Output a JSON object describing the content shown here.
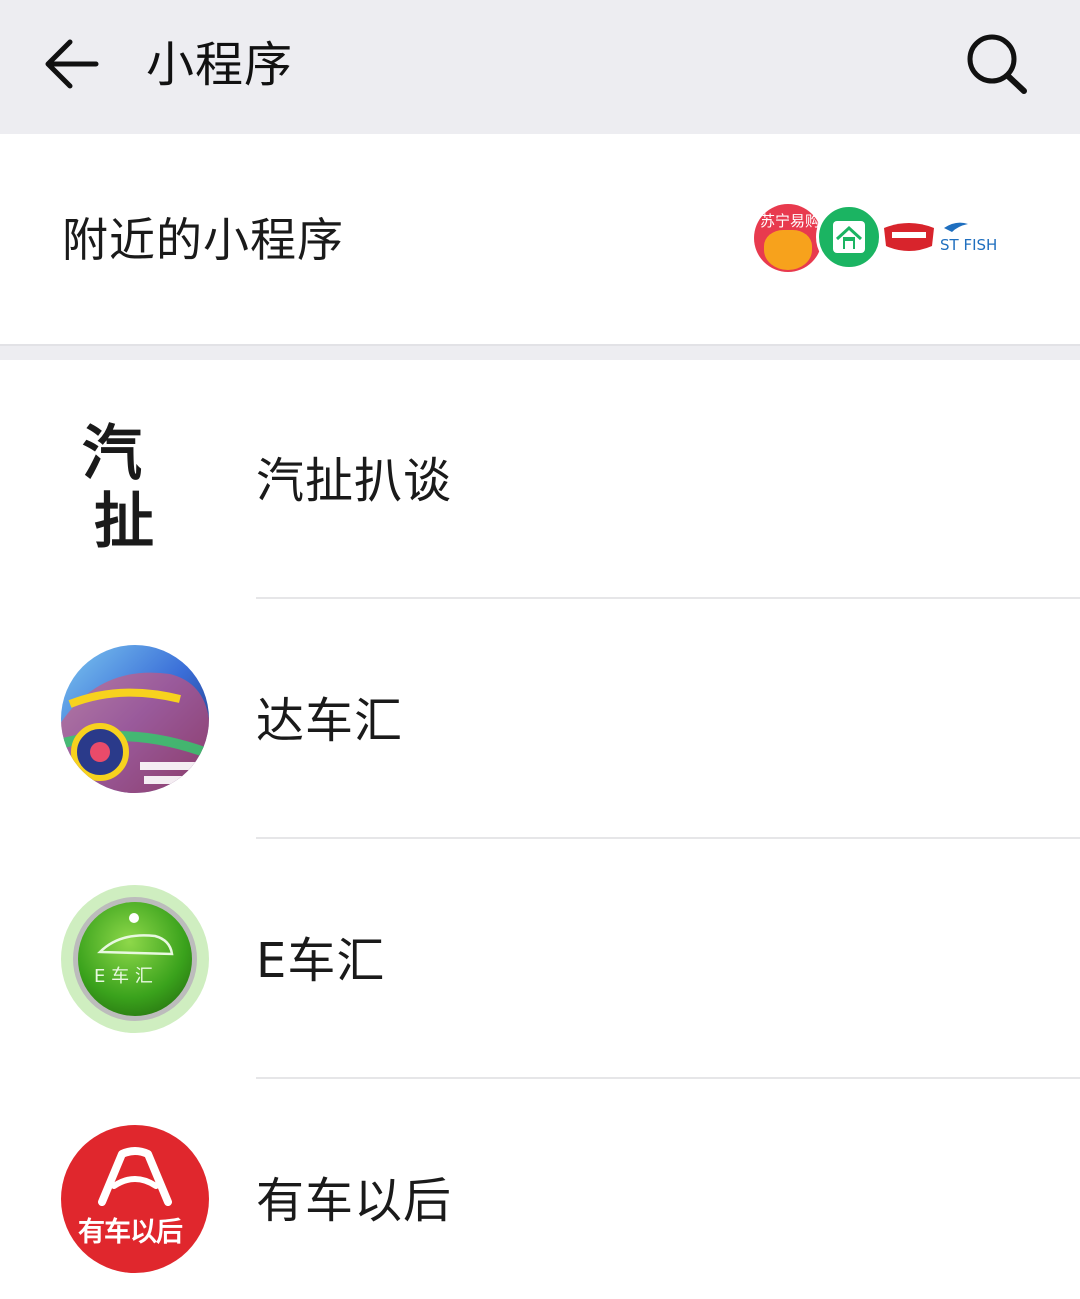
{
  "header": {
    "title": "小程序",
    "back_icon": "arrow-left-icon",
    "search_icon": "search-icon"
  },
  "nearby": {
    "label": "附近的小程序",
    "icons": [
      "suning-icon",
      "house-icon",
      "red-badge-icon",
      "st-fish-icon"
    ],
    "suning_text": "苏宁易购",
    "fish_text": "ST FISH"
  },
  "list": {
    "items": [
      {
        "label": "汽扯扒谈",
        "icon": "calligraphy-logo-icon",
        "icon_text": "汽扯"
      },
      {
        "label": "达车汇",
        "icon": "painted-car-icon"
      },
      {
        "label": "E车汇",
        "icon": "green-car-badge-icon",
        "icon_text": "E 车 汇"
      },
      {
        "label": "有车以后",
        "icon": "red-car-logo-icon",
        "icon_text": "有车以后"
      }
    ]
  },
  "colors": {
    "header_bg": "#ededf1",
    "band_bg": "#ededf1",
    "separator": "#e6e6e8",
    "text": "#1a1a1a"
  }
}
